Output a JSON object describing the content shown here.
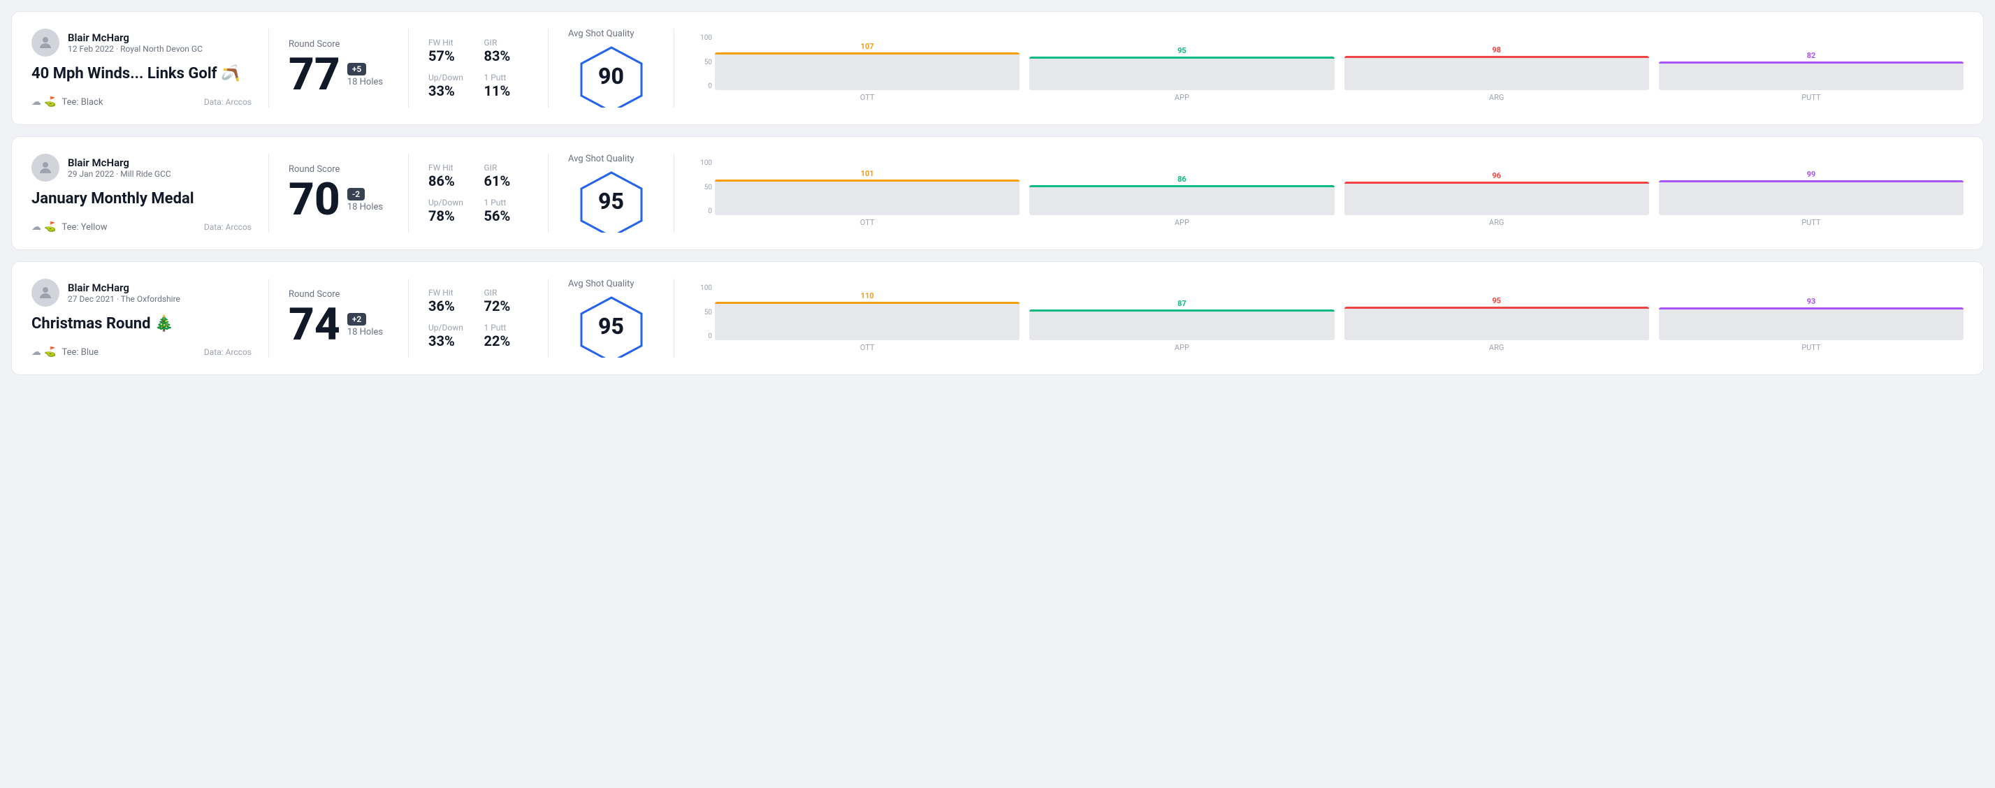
{
  "rounds": [
    {
      "id": "round1",
      "player_name": "Blair McHarg",
      "player_meta": "12 Feb 2022 · Royal North Devon GC",
      "round_title": "40 Mph Winds... Links Golf 🪃",
      "tee": "Black",
      "data_source": "Data: Arccos",
      "score": "77",
      "score_diff": "+5",
      "score_diff_type": "positive",
      "holes": "18 Holes",
      "fw_hit": "57%",
      "gir": "83%",
      "up_down": "33%",
      "one_putt": "11%",
      "avg_shot_quality": "90",
      "chart": {
        "bars": [
          {
            "label": "OTT",
            "value": 107,
            "color": "#f59e0b",
            "max": 130
          },
          {
            "label": "APP",
            "value": 95,
            "color": "#10b981",
            "max": 130
          },
          {
            "label": "ARG",
            "value": 98,
            "color": "#ef4444",
            "max": 130
          },
          {
            "label": "PUTT",
            "value": 82,
            "color": "#a855f7",
            "max": 130
          }
        ]
      }
    },
    {
      "id": "round2",
      "player_name": "Blair McHarg",
      "player_meta": "29 Jan 2022 · Mill Ride GCC",
      "round_title": "January Monthly Medal",
      "tee": "Yellow",
      "data_source": "Data: Arccos",
      "score": "70",
      "score_diff": "-2",
      "score_diff_type": "negative",
      "holes": "18 Holes",
      "fw_hit": "86%",
      "gir": "61%",
      "up_down": "78%",
      "one_putt": "56%",
      "avg_shot_quality": "95",
      "chart": {
        "bars": [
          {
            "label": "OTT",
            "value": 101,
            "color": "#f59e0b",
            "max": 130
          },
          {
            "label": "APP",
            "value": 86,
            "color": "#10b981",
            "max": 130
          },
          {
            "label": "ARG",
            "value": 96,
            "color": "#ef4444",
            "max": 130
          },
          {
            "label": "PUTT",
            "value": 99,
            "color": "#a855f7",
            "max": 130
          }
        ]
      }
    },
    {
      "id": "round3",
      "player_name": "Blair McHarg",
      "player_meta": "27 Dec 2021 · The Oxfordshire",
      "round_title": "Christmas Round 🎄",
      "tee": "Blue",
      "data_source": "Data: Arccos",
      "score": "74",
      "score_diff": "+2",
      "score_diff_type": "positive",
      "holes": "18 Holes",
      "fw_hit": "36%",
      "gir": "72%",
      "up_down": "33%",
      "one_putt": "22%",
      "avg_shot_quality": "95",
      "chart": {
        "bars": [
          {
            "label": "OTT",
            "value": 110,
            "color": "#f59e0b",
            "max": 130
          },
          {
            "label": "APP",
            "value": 87,
            "color": "#10b981",
            "max": 130
          },
          {
            "label": "ARG",
            "value": 95,
            "color": "#ef4444",
            "max": 130
          },
          {
            "label": "PUTT",
            "value": 93,
            "color": "#a855f7",
            "max": 130
          }
        ]
      }
    }
  ],
  "labels": {
    "round_score": "Round Score",
    "avg_shot_quality": "Avg Shot Quality",
    "fw_hit": "FW Hit",
    "gir": "GIR",
    "up_down": "Up/Down",
    "one_putt": "1 Putt",
    "tee_prefix": "Tee:",
    "y_axis_100": "100",
    "y_axis_50": "50",
    "y_axis_0": "0"
  }
}
